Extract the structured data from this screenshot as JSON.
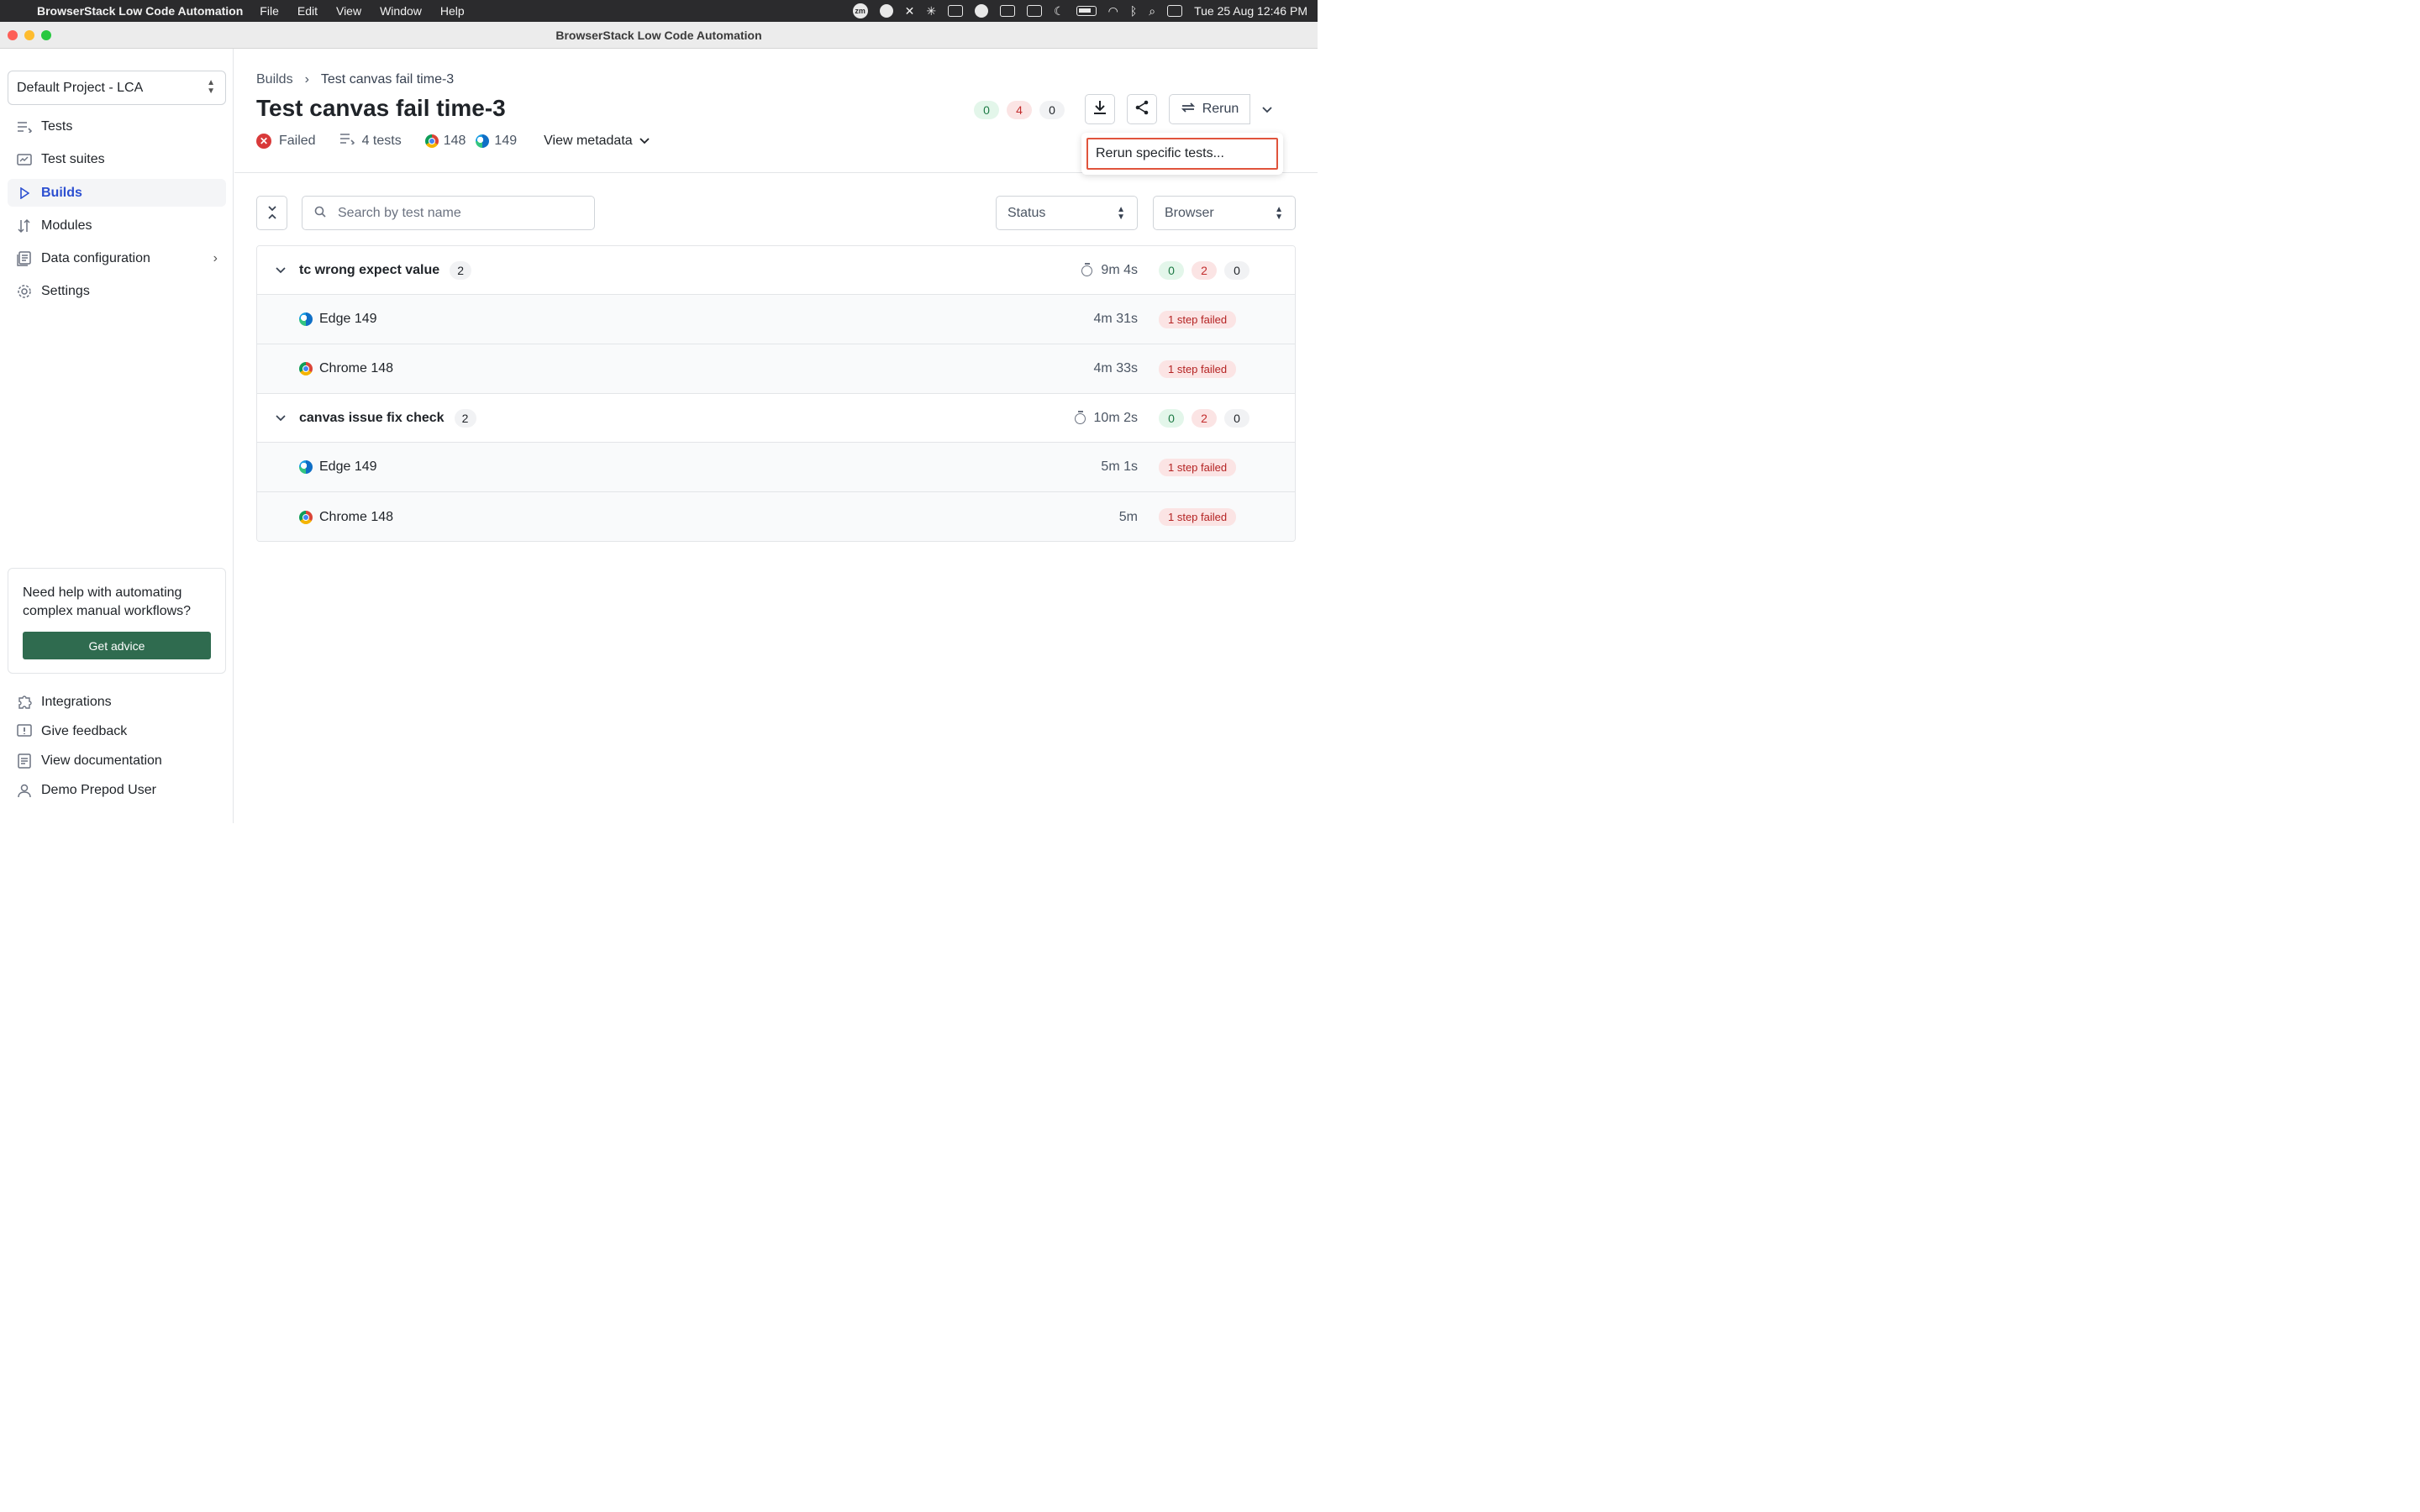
{
  "menubar": {
    "app_name": "BrowserStack Low Code Automation",
    "menus": [
      "File",
      "Edit",
      "View",
      "Window",
      "Help"
    ],
    "clock": "Tue 25 Aug  12:46 PM"
  },
  "window": {
    "title": "BrowserStack Low Code Automation"
  },
  "sidebar": {
    "project": "Default Project - LCA",
    "items": [
      {
        "label": "Tests",
        "icon": "list-icon"
      },
      {
        "label": "Test suites",
        "icon": "test-suites-icon"
      },
      {
        "label": "Builds",
        "icon": "play-icon",
        "active": true
      },
      {
        "label": "Modules",
        "icon": "modules-icon"
      },
      {
        "label": "Data configuration",
        "icon": "data-icon"
      },
      {
        "label": "Settings",
        "icon": "gear-icon"
      }
    ],
    "help": {
      "text": "Need help with automating complex manual workflows?",
      "button": "Get advice"
    },
    "footer": [
      {
        "label": "Integrations",
        "icon": "puzzle-icon"
      },
      {
        "label": "Give feedback",
        "icon": "feedback-icon"
      },
      {
        "label": "View documentation",
        "icon": "document-icon"
      },
      {
        "label": "Demo Prepod User",
        "icon": "user-icon"
      }
    ]
  },
  "build": {
    "breadcrumb": {
      "parent": "Builds",
      "current": "Test canvas fail time-3"
    },
    "title": "Test canvas fail time-3",
    "status": "Failed",
    "tests": "4 tests",
    "chrome_version": "148",
    "edge_version": "149",
    "view_metadata": "View metadata",
    "counts": {
      "passed": "0",
      "failed": "4",
      "other": "0"
    },
    "rerun_label": "Rerun",
    "rerun_menu_item": "Rerun specific tests..."
  },
  "filters": {
    "search_placeholder": "Search by test name",
    "status_label": "Status",
    "browser_label": "Browser"
  },
  "groups": [
    {
      "name": "tc wrong expect value",
      "count": "2",
      "duration": "9m 4s",
      "passed": "0",
      "failed": "2",
      "other": "0",
      "runs": [
        {
          "browser": "Edge 149",
          "type": "edge",
          "duration": "4m 31s",
          "result": "1 step failed"
        },
        {
          "browser": "Chrome 148",
          "type": "chrome",
          "duration": "4m 33s",
          "result": "1 step failed"
        }
      ]
    },
    {
      "name": "canvas issue fix check",
      "count": "2",
      "duration": "10m 2s",
      "passed": "0",
      "failed": "2",
      "other": "0",
      "runs": [
        {
          "browser": "Edge 149",
          "type": "edge",
          "duration": "5m 1s",
          "result": "1 step failed"
        },
        {
          "browser": "Chrome 148",
          "type": "chrome",
          "duration": "5m",
          "result": "1 step failed"
        }
      ]
    }
  ],
  "colors": {
    "accent": "#2c4fd1",
    "fail": "#d93a3a",
    "cta": "#2f6b4f",
    "focus": "#e0543c"
  }
}
